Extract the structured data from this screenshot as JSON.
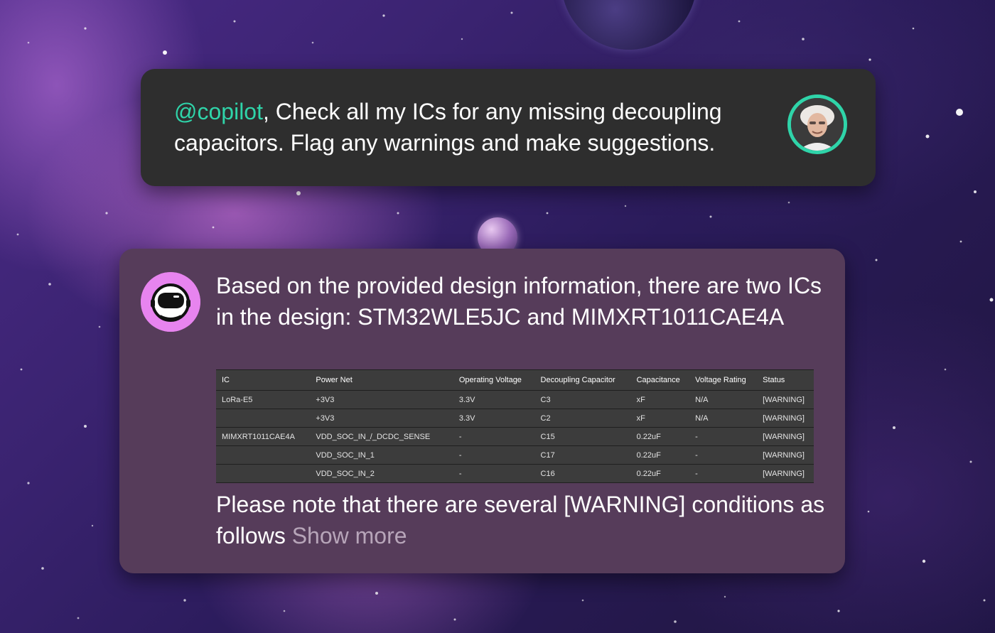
{
  "user_message": {
    "mention": "@copilot",
    "text": ", Check all my ICs for any missing decoupling capacitors. Flag any warnings and make suggestions."
  },
  "bot_message": {
    "intro": "Based on the provided design information, there are two ICs in the design: STM32WLE5JC and MIMXRT1011CAE4A",
    "table": {
      "headers": [
        "IC",
        "Power Net",
        "Operating Voltage",
        "Decoupling Capacitor",
        "Capacitance",
        "Voltage Rating",
        "Status"
      ],
      "rows": [
        [
          "LoRa-E5",
          "+3V3",
          "3.3V",
          "C3",
          "xF",
          "N/A",
          "[WARNING]"
        ],
        [
          "",
          "+3V3",
          "3.3V",
          "C2",
          "xF",
          "N/A",
          "[WARNING]"
        ],
        [
          "MIMXRT1011CAE4A",
          "VDD_SOC_IN_/_DCDC_SENSE",
          "-",
          "C15",
          "0.22uF",
          "-",
          "[WARNING]"
        ],
        [
          "",
          "VDD_SOC_IN_1",
          "-",
          "C17",
          "0.22uF",
          "-",
          "[WARNING]"
        ],
        [
          "",
          "VDD_SOC_IN_2",
          "-",
          "C16",
          "0.22uF",
          "-",
          "[WARNING]"
        ]
      ]
    },
    "note": "Please note that there are several [WARNING] conditions as follows",
    "show_more": "Show more"
  },
  "icons": {
    "user_avatar": "user-avatar-photo",
    "bot_avatar": "astronaut-helmet-icon"
  },
  "colors": {
    "mention": "#2fd4a9",
    "user_bubble": "#2e2e2e",
    "bot_bubble": "#563c5a",
    "bot_avatar_bg": "#e784ef"
  }
}
